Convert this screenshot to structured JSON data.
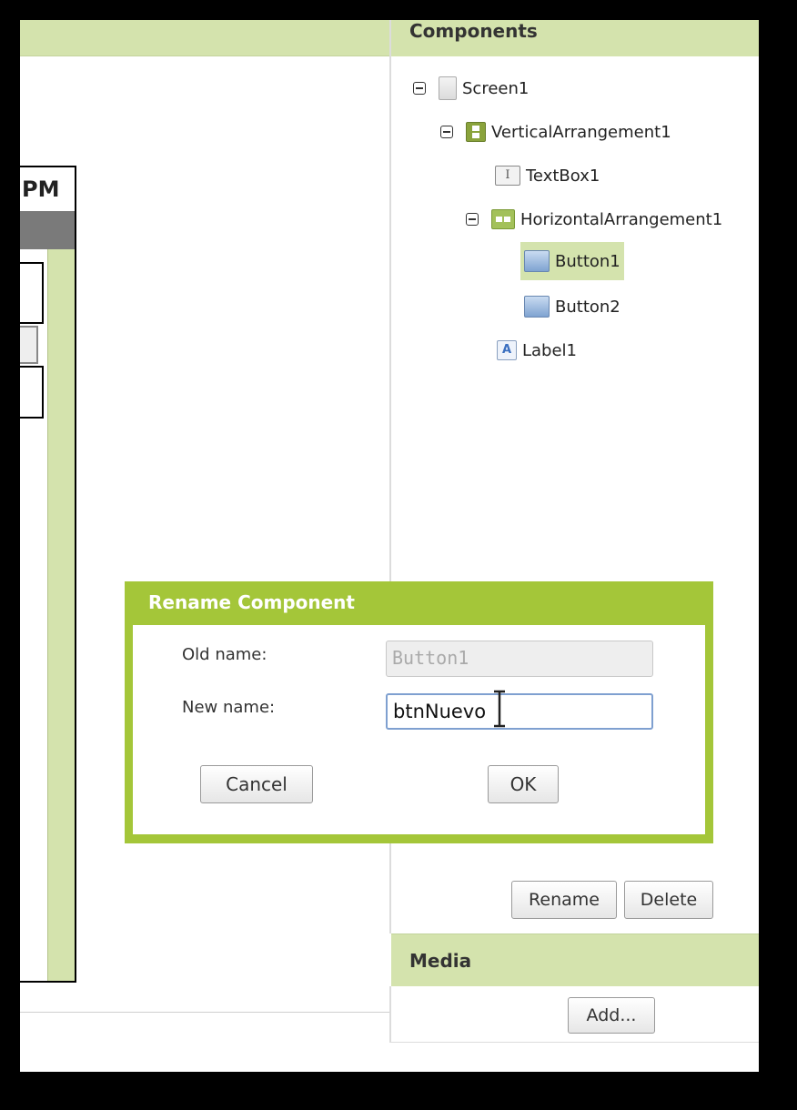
{
  "viewer": {
    "phone_title_fragment": "PM"
  },
  "components": {
    "header": "Components",
    "tree": [
      {
        "label": "Screen1",
        "icon": "screen-icon"
      },
      {
        "label": "VerticalArrangement1",
        "icon": "vertical-arrangement-icon"
      },
      {
        "label": "TextBox1",
        "icon": "textbox-icon"
      },
      {
        "label": "HorizontalArrangement1",
        "icon": "horizontal-arrangement-icon"
      },
      {
        "label": "Button1",
        "icon": "button-icon",
        "selected": true
      },
      {
        "label": "Button2",
        "icon": "button-icon"
      },
      {
        "label": "Label1",
        "icon": "label-icon"
      }
    ],
    "rename_label": "Rename",
    "delete_label": "Delete"
  },
  "media": {
    "header": "Media",
    "add_label": "Add..."
  },
  "dialog": {
    "title": "Rename Component",
    "old_name_label": "Old name:",
    "old_name_value": "Button1",
    "new_name_label": "New name:",
    "new_name_value": "btnNuevo",
    "cancel_label": "Cancel",
    "ok_label": "OK"
  },
  "colors": {
    "accent_green": "#a4c639",
    "panel_green": "#d4e3ad"
  }
}
